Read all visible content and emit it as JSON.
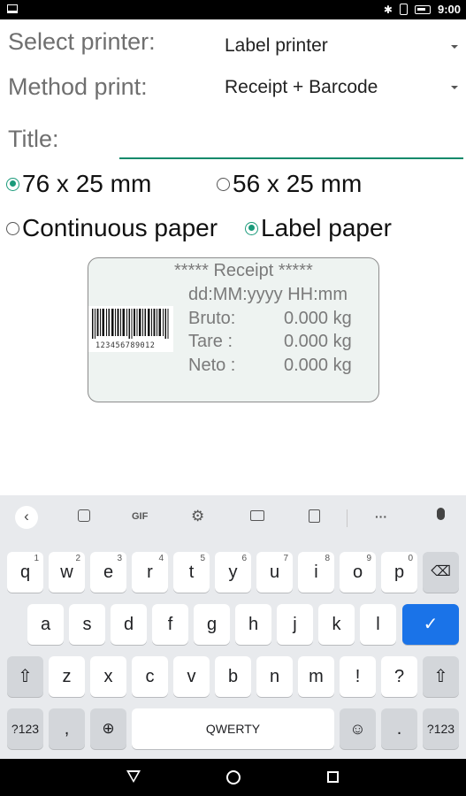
{
  "status_bar": {
    "time": "9:00",
    "icons": [
      "screen-icon",
      "bluetooth-icon",
      "vibrate-icon",
      "battery-icon"
    ]
  },
  "form": {
    "select_printer_label": "Select printer:",
    "select_printer_value": "Label printer",
    "method_print_label": "Method print:",
    "method_print_value": "Receipt + Barcode",
    "title_label": "Title:",
    "title_value": "",
    "size_options": [
      {
        "label": "76 x 25 mm",
        "selected": true
      },
      {
        "label": "56 x 25 mm",
        "selected": false
      }
    ],
    "paper_options": [
      {
        "label": "Continuous paper",
        "selected": false
      },
      {
        "label": "Label paper",
        "selected": true
      }
    ],
    "accent_color": "#1a9a7a"
  },
  "receipt_preview": {
    "header": "***** Receipt *****",
    "datetime": "dd:MM:yyyy HH:mm",
    "rows": [
      {
        "label": "Bruto:",
        "value": "0.000 kg"
      },
      {
        "label": "Tare :",
        "value": "0.000 kg"
      },
      {
        "label": "Neto :",
        "value": "0.000 kg"
      }
    ],
    "barcode_number": "123456789012"
  },
  "keyboard": {
    "toolbar": [
      "back-icon",
      "sticker-icon",
      "GIF",
      "gear-icon",
      "translate-icon",
      "clipboard-icon",
      "more-icon",
      "mic-icon"
    ],
    "gif_label": "GIF",
    "more_label": "···",
    "row1": [
      {
        "key": "q",
        "hint": "1"
      },
      {
        "key": "w",
        "hint": "2"
      },
      {
        "key": "e",
        "hint": "3"
      },
      {
        "key": "r",
        "hint": "4"
      },
      {
        "key": "t",
        "hint": "5"
      },
      {
        "key": "y",
        "hint": "6"
      },
      {
        "key": "u",
        "hint": "7"
      },
      {
        "key": "i",
        "hint": "8"
      },
      {
        "key": "o",
        "hint": "9"
      },
      {
        "key": "p",
        "hint": "0"
      }
    ],
    "row2": [
      "a",
      "s",
      "d",
      "f",
      "g",
      "h",
      "j",
      "k",
      "l"
    ],
    "row3": [
      "z",
      "x",
      "c",
      "v",
      "b",
      "n",
      "m",
      "!",
      "?"
    ],
    "symbols_label": "?123",
    "comma_label": ",",
    "space_label": "QWERTY",
    "period_label": ".",
    "enter_color": "#1a73e8"
  }
}
